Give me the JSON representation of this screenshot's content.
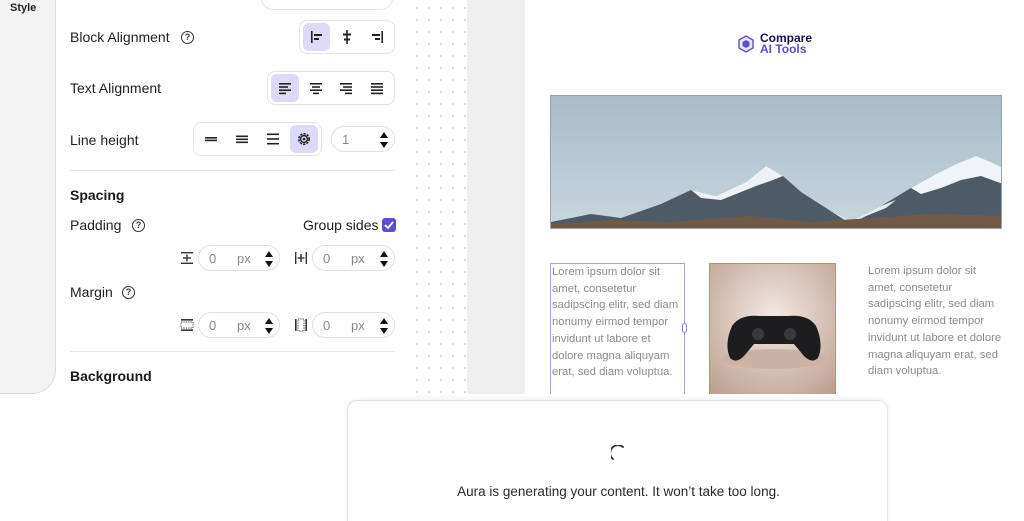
{
  "rail": {
    "label": "Style"
  },
  "block_alignment": {
    "label": "Block Alignment",
    "help": "?",
    "options": [
      "align-left",
      "align-center",
      "align-right"
    ],
    "selected": "align-left"
  },
  "text_alignment": {
    "label": "Text Alignment",
    "options": [
      "left",
      "center",
      "right",
      "justify"
    ],
    "selected": "left"
  },
  "line_height": {
    "label": "Line height",
    "options": [
      "compact",
      "normal",
      "loose",
      "custom"
    ],
    "selected": "custom",
    "value": "1"
  },
  "spacing": {
    "title": "Spacing",
    "padding": {
      "label": "Padding",
      "help": "?",
      "group_sides_label": "Group sides",
      "group_sides_checked": true,
      "vertical": {
        "value": "0",
        "unit": "px"
      },
      "horizontal": {
        "value": "0",
        "unit": "px"
      }
    },
    "margin": {
      "label": "Margin",
      "help": "?",
      "vertical": {
        "value": "0",
        "unit": "px"
      },
      "horizontal": {
        "value": "0",
        "unit": "px"
      }
    }
  },
  "background": {
    "title": "Background"
  },
  "canvas": {
    "logo": {
      "line1": "Compare",
      "line2": "AI Tools",
      "accent_color": "#5b4fcf",
      "text_color": "#121247"
    },
    "col_left_text": "Lorem ipsum dolor sit amet, consetetur sadipscing elitr, sed diam nonumy eirmod tempor invidunt ut labore et dolore magna aliquyam erat, sed diam voluptua.",
    "col_right_text": "Lorem ipsum dolor sit amet, consetetur sadipscing elitr, sed diam nonumy eirmod tempor invidunt ut labore et dolore magna aliquyam erat, sed diam voluptua.",
    "banner_image": "snowy-mountains",
    "product_image": "game-controller"
  },
  "modal": {
    "message": "Aura is generating your content. It won’t take too long."
  },
  "colors": {
    "accent": "#5b4fcf",
    "active_bg": "#dcdaf7"
  }
}
